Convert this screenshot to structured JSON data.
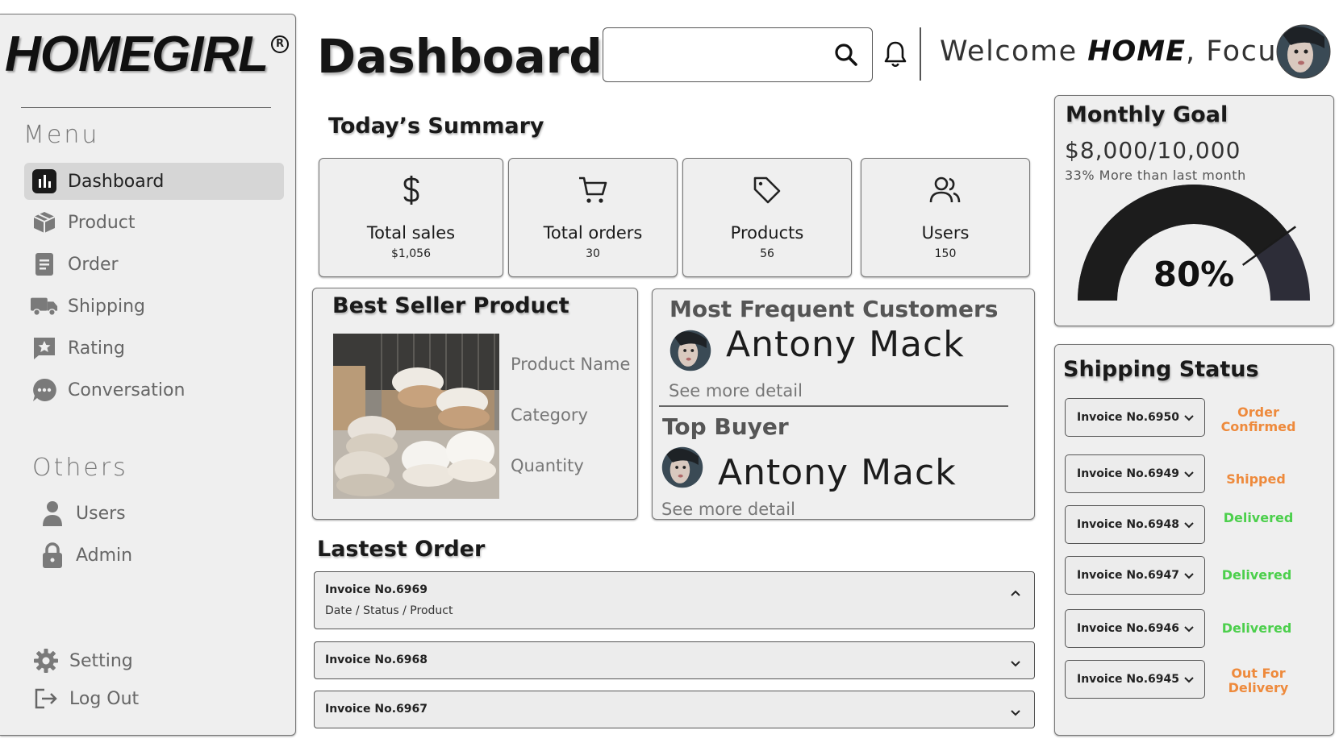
{
  "brand": {
    "logo": "HOMEGIRL",
    "registered_mark": "R"
  },
  "sidebar": {
    "menu_heading": "Menu",
    "items": [
      {
        "label": "Dashboard",
        "icon": "chart-bars-icon",
        "active": true
      },
      {
        "label": "Product",
        "icon": "box-icon"
      },
      {
        "label": "Order",
        "icon": "document-icon"
      },
      {
        "label": "Shipping",
        "icon": "truck-icon"
      },
      {
        "label": "Rating",
        "icon": "star-message-icon"
      },
      {
        "label": "Conversation",
        "icon": "chat-bubble-icon"
      }
    ],
    "others_heading": "Others",
    "others": [
      {
        "label": "Users",
        "icon": "person-icon"
      },
      {
        "label": "Admin",
        "icon": "lock-icon"
      }
    ],
    "footer": [
      {
        "label": "Setting",
        "icon": "gear-icon"
      },
      {
        "label": "Log Out",
        "icon": "logout-icon"
      }
    ]
  },
  "header": {
    "title": "Dashboard",
    "search_value": "",
    "welcome_prefix": "Welcome ",
    "welcome_bold": "HOME",
    "welcome_suffix": ", Focus"
  },
  "summary": {
    "title": "Today’s Summary",
    "cards": [
      {
        "label": "Total sales",
        "value": "$1,056",
        "icon": "dollar-icon"
      },
      {
        "label": "Total orders",
        "value": "30",
        "icon": "cart-icon"
      },
      {
        "label": "Products",
        "value": "56",
        "icon": "tag-icon"
      },
      {
        "label": "Users",
        "value": "150",
        "icon": "users-icon"
      }
    ]
  },
  "best_seller": {
    "title": "Best Seller Product",
    "fields": [
      "Product Name",
      "Category",
      "Quantity"
    ]
  },
  "customers": {
    "frequent_title": "Most Frequent Customers",
    "frequent_name": "Antony Mack",
    "frequent_link": "See more detail",
    "buyer_title": "Top Buyer",
    "buyer_name": "Antony Mack",
    "buyer_link": "See more detail"
  },
  "latest_order": {
    "title": "Lastest Order",
    "orders": [
      {
        "invoice": "Invoice No.6969",
        "detail": "Date / Status / Product",
        "expanded": true
      },
      {
        "invoice": "Invoice No.6968",
        "expanded": false
      },
      {
        "invoice": "Invoice No.6967",
        "expanded": false
      }
    ]
  },
  "monthly_goal": {
    "title": "Monthly Goal",
    "amount": "$8,000/10,000",
    "comparison": "33% More than last month",
    "percent_label": "80%",
    "progress": 0.8,
    "colors": {
      "filled": "#1c1c1c",
      "remaining": "#2d2d38"
    }
  },
  "shipping": {
    "title": "Shipping Status",
    "items": [
      {
        "invoice": "Invoice No.6950",
        "status": "Order Confirmed",
        "color": "#ee8a3c"
      },
      {
        "invoice": "Invoice No.6949",
        "status": "Shipped",
        "color": "#ee8a3c"
      },
      {
        "invoice": "Invoice No.6948",
        "status": "Delivered",
        "color": "#4ccf4c"
      },
      {
        "invoice": "Invoice No.6947",
        "status": "Delivered",
        "color": "#4ccf4c"
      },
      {
        "invoice": "Invoice No.6946",
        "status": "Delivered",
        "color": "#4ccf4c"
      },
      {
        "invoice": "Invoice No.6945",
        "status": "Out For Delivery",
        "color": "#ee8a3c"
      }
    ]
  }
}
